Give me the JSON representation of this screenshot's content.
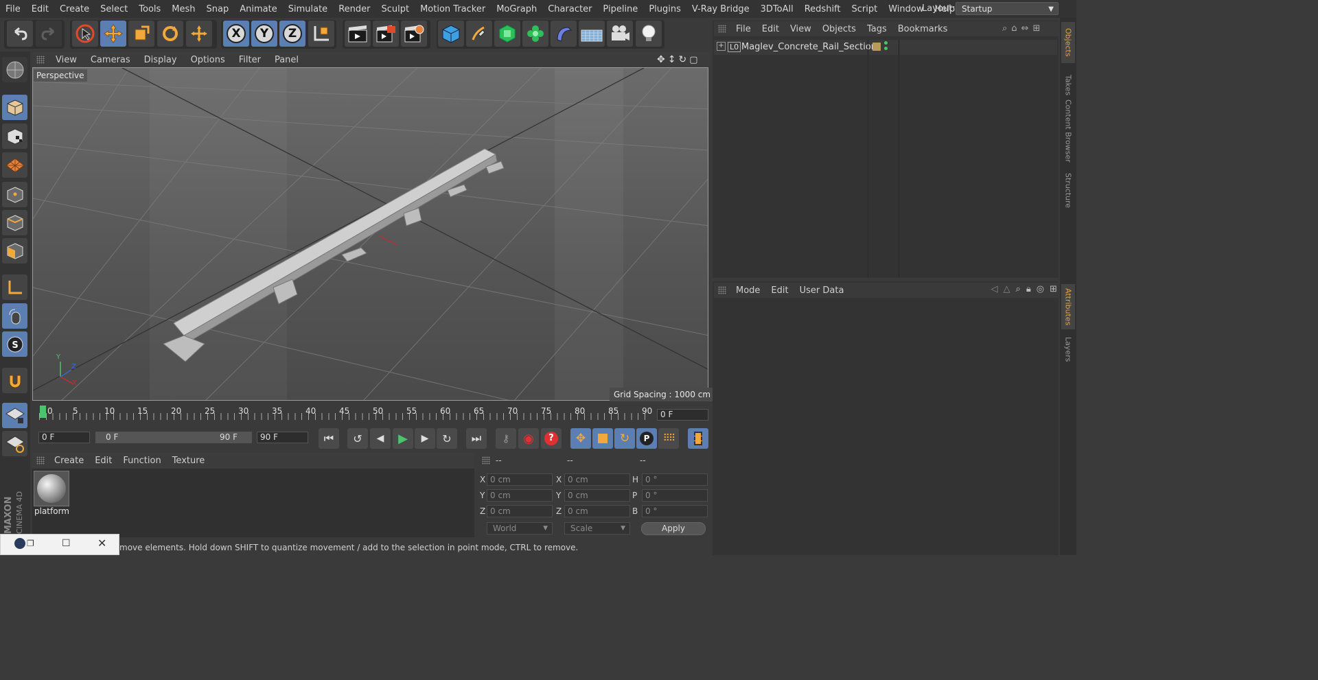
{
  "menu": [
    "File",
    "Edit",
    "Create",
    "Select",
    "Tools",
    "Mesh",
    "Snap",
    "Animate",
    "Simulate",
    "Render",
    "Sculpt",
    "Motion Tracker",
    "MoGraph",
    "Character",
    "Pipeline",
    "Plugins",
    "V-Ray Bridge",
    "3DToAll",
    "Redshift",
    "Script",
    "Window",
    "Help"
  ],
  "layout": {
    "label": "Layout:",
    "value": "Startup"
  },
  "axes": {
    "x": "X",
    "y": "Y",
    "z": "Z"
  },
  "viewport": {
    "menu": [
      "View",
      "Cameras",
      "Display",
      "Options",
      "Filter",
      "Panel"
    ],
    "label": "Perspective",
    "grid_spacing": "Grid Spacing : 1000 cm",
    "axis_y": "Y",
    "axis_z": "Z",
    "axis_x": "X"
  },
  "timeline": {
    "ticks": [
      "0",
      "5",
      "10",
      "15",
      "20",
      "25",
      "30",
      "35",
      "40",
      "45",
      "50",
      "55",
      "60",
      "65",
      "70",
      "75",
      "80",
      "85",
      "90"
    ],
    "current": "0 F",
    "start": "0 F",
    "range_start": "0 F",
    "range_end": "90 F",
    "end": "90 F"
  },
  "material_manager": {
    "menu": [
      "Create",
      "Edit",
      "Function",
      "Texture"
    ],
    "material_name": "platform"
  },
  "coordinates": {
    "headers": [
      "--",
      "--",
      "--"
    ],
    "rows": [
      {
        "a": "X",
        "av": "0 cm",
        "b": "X",
        "bv": "0 cm",
        "c": "H",
        "cv": "0 °"
      },
      {
        "a": "Y",
        "av": "0 cm",
        "b": "Y",
        "bv": "0 cm",
        "c": "P",
        "cv": "0 °"
      },
      {
        "a": "Z",
        "av": "0 cm",
        "b": "Z",
        "bv": "0 cm",
        "c": "B",
        "cv": "0 °"
      }
    ],
    "world": "World",
    "scale": "Scale",
    "apply": "Apply"
  },
  "objects": {
    "menu": [
      "File",
      "Edit",
      "View",
      "Objects",
      "Tags",
      "Bookmarks"
    ],
    "items": [
      {
        "name": "Maglev_Concrete_Rail_Section",
        "layer": "L0"
      }
    ]
  },
  "attributes": {
    "menu": [
      "Mode",
      "Edit",
      "User Data"
    ]
  },
  "right_tabs": [
    "Objects",
    "Takes",
    "Content Browser",
    "Structure",
    "Attributes",
    "Layers"
  ],
  "status": "move elements. Hold down SHIFT to quantize movement / add to the selection in point mode, CTRL to remove.",
  "brand": "MAXON CINEMA 4D",
  "colors": {
    "accent": "#5b7fb3",
    "orange": "#e8a33a",
    "green": "#4cc46a"
  }
}
